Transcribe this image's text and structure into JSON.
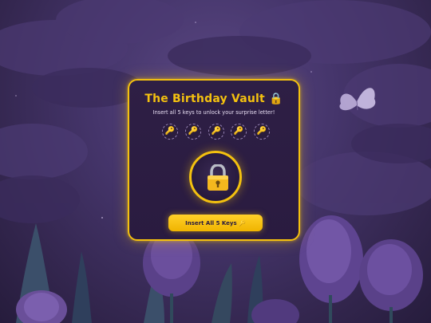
{
  "vault": {
    "title": "The Birthday Vault 🔒",
    "subtitle": "Insert all 5 keys to unlock your surprise letter!",
    "key_slots": [
      {
        "icon": "key-icon",
        "glyph": "🔑"
      },
      {
        "icon": "key-icon",
        "glyph": "🔑"
      },
      {
        "icon": "key-icon",
        "glyph": "🔑"
      },
      {
        "icon": "key-icon",
        "glyph": "🔑"
      },
      {
        "icon": "key-icon",
        "glyph": "🔑"
      }
    ],
    "lock_icon": "padlock-icon",
    "button_label": "Insert All 5 Keys 🔑"
  },
  "background": {
    "scene": "night sky with clouds, tulips and a butterfly"
  },
  "colors": {
    "accent": "#f4c10f",
    "card_bg": "#2a1b40",
    "sky": "#45356b",
    "button_text": "#2a1b40"
  }
}
